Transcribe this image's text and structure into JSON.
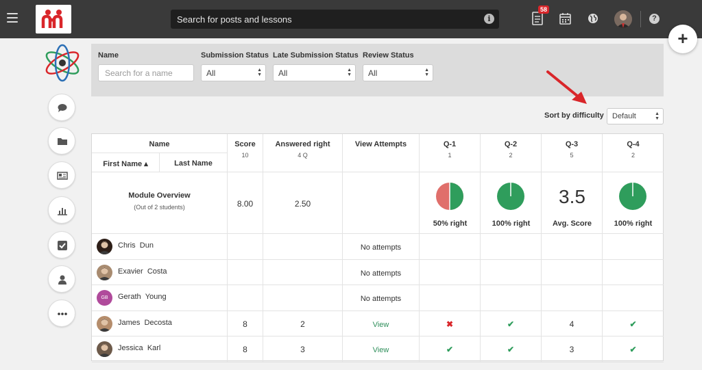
{
  "topbar": {
    "search_placeholder": "Search for posts and lessons",
    "notification_count": "58"
  },
  "filters": {
    "name_label": "Name",
    "name_placeholder": "Search for a name",
    "submission_label": "Submission Status",
    "submission_value": "All",
    "late_label": "Late Submission Status",
    "late_value": "All",
    "review_label": "Review Status",
    "review_value": "All"
  },
  "sort": {
    "label": "Sort by difficulty",
    "value": "Default"
  },
  "table": {
    "headers": {
      "name": "Name",
      "first_name": "First Name ▴",
      "last_name": "Last Name",
      "score": "Score",
      "score_sub": "10",
      "answered": "Answered right",
      "answered_sub": "4 Q",
      "attempts": "View Attempts",
      "questions": [
        {
          "label": "Q-1",
          "sub": "1"
        },
        {
          "label": "Q-2",
          "sub": "2"
        },
        {
          "label": "Q-3",
          "sub": "5"
        },
        {
          "label": "Q-4",
          "sub": "2"
        }
      ]
    },
    "overview": {
      "title": "Module Overview",
      "subtitle": "(Out of 2 students)",
      "score": "8.00",
      "answered": "2.50",
      "q1_label": "50% right",
      "q1_fraction": 0.5,
      "q2_label": "100% right",
      "q2_fraction": 1.0,
      "q3_value": "3.5",
      "q3_label": "Avg. Score",
      "q4_label": "100% right",
      "q4_fraction": 1.0
    },
    "rows": [
      {
        "first": "Chris",
        "last": "Dun",
        "score": "",
        "answered": "",
        "attempts": "No attempts",
        "q": [
          "",
          "",
          "",
          ""
        ]
      },
      {
        "first": "Exavier",
        "last": "Costa",
        "score": "",
        "answered": "",
        "attempts": "No attempts",
        "q": [
          "",
          "",
          "",
          ""
        ]
      },
      {
        "first": "Gerath",
        "last": "Young",
        "initials": "GB",
        "score": "",
        "answered": "",
        "attempts": "No attempts",
        "q": [
          "",
          "",
          "",
          ""
        ]
      },
      {
        "first": "James",
        "last": "Decosta",
        "score": "8",
        "answered": "2",
        "attempts": "View",
        "q": [
          "wrong",
          "right",
          "4",
          "right"
        ]
      },
      {
        "first": "Jessica",
        "last": "Karl",
        "score": "8",
        "answered": "3",
        "attempts": "View",
        "q": [
          "right",
          "right",
          "3",
          "right"
        ]
      }
    ]
  },
  "colors": {
    "topbar": "#3a3a3a",
    "pie_green": "#2f9d5c",
    "pie_red": "#e06f6b",
    "link_green": "#2f8f5b",
    "arrow_red": "#d9262a"
  }
}
